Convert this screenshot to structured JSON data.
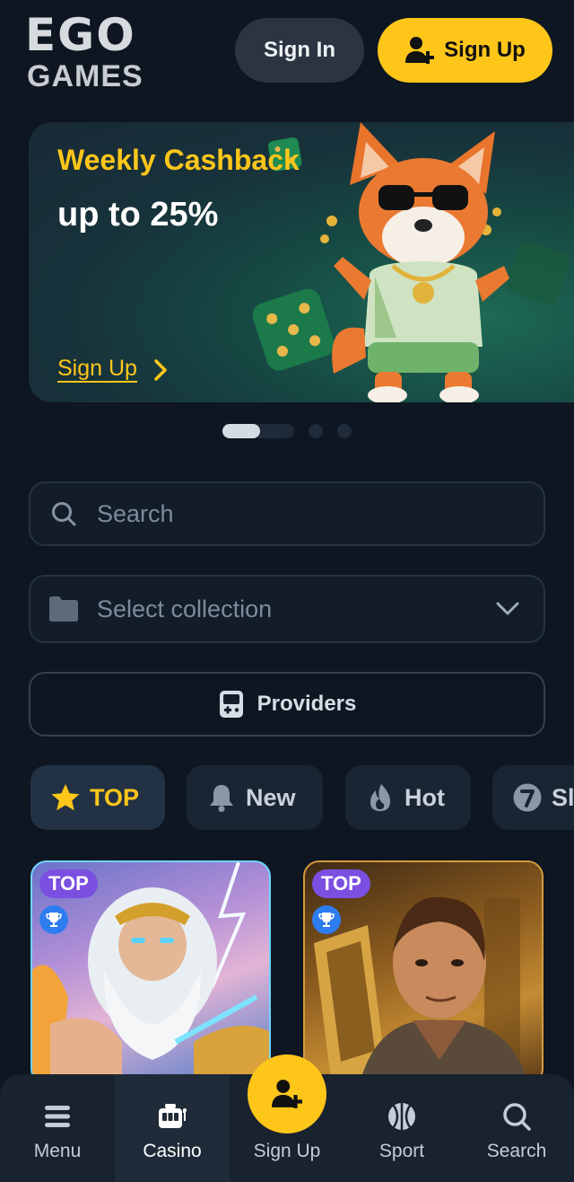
{
  "header": {
    "logo_top": "EGO",
    "logo_bottom": "GAMES",
    "sign_in_label": "Sign In",
    "sign_up_label": "Sign Up"
  },
  "banner": {
    "title": "Weekly Cashback",
    "subtitle": "up to 25%",
    "cta_label": "Sign Up",
    "slides_total": 3,
    "active_slide": 1
  },
  "search": {
    "placeholder": "Search"
  },
  "collection": {
    "placeholder": "Select collection"
  },
  "providers": {
    "label": "Providers"
  },
  "tabs": [
    {
      "label": "TOP",
      "icon": "star-icon",
      "active": true
    },
    {
      "label": "New",
      "icon": "bell-icon",
      "active": false
    },
    {
      "label": "Hot",
      "icon": "flame-icon",
      "active": false
    },
    {
      "label": "Sl",
      "icon": "seven-icon",
      "active": false
    }
  ],
  "games": [
    {
      "badge": "TOP",
      "icon": "trophy-icon"
    },
    {
      "badge": "TOP",
      "icon": "trophy-icon"
    }
  ],
  "bottom_nav": {
    "items": [
      {
        "label": "Menu",
        "icon": "hamburger-icon",
        "active": false
      },
      {
        "label": "Casino",
        "icon": "slot-machine-icon",
        "active": true
      },
      {
        "label": "Sign Up",
        "icon": "add-user-icon",
        "active": false
      },
      {
        "label": "Sport",
        "icon": "basketball-icon",
        "active": false
      },
      {
        "label": "Search",
        "icon": "search-icon",
        "active": false
      }
    ]
  },
  "colors": {
    "background": "#0e1621",
    "accent": "#ffc61a",
    "badge": "#7b4fe0",
    "trophy": "#2e7df0"
  }
}
